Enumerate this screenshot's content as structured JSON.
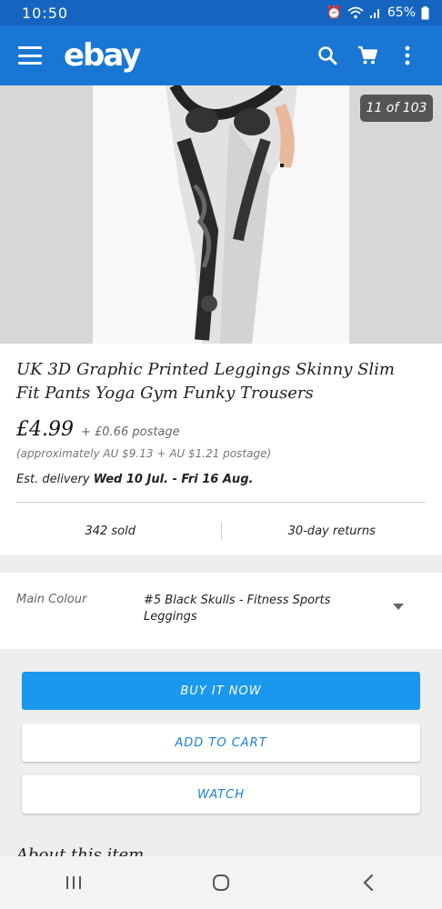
{
  "status_bar": {
    "time": "10:50",
    "battery": "65%"
  },
  "app_bar": {
    "logo": "ebay",
    "icons": [
      "menu-icon",
      "search-icon",
      "cart-icon",
      "more-vert-icon"
    ]
  },
  "gallery": {
    "counter": "11 of 103"
  },
  "item": {
    "title": "UK 3D Graphic Printed  Leggings Skinny Slim Fit Pants Yoga Gym Funky Trousers",
    "price": "£4.99",
    "postage": "+ £0.66 postage",
    "approx": "(approximately AU $9.13 + AU $1.21 postage)",
    "delivery_label": "Est. delivery",
    "delivery_dates": "Wed 10 Jul. - Fri 16 Aug.",
    "sold": "342 sold",
    "returns": "30-day returns"
  },
  "variation": {
    "label": "Main Colour",
    "value": "#5 Black Skulls - Fitness Sports Leggings"
  },
  "actions": {
    "buy_now": "BUY IT NOW",
    "add_to_cart": "ADD TO CART",
    "watch": "WATCH"
  },
  "about": {
    "heading": "About this item"
  },
  "colors": {
    "status_bar": "#1565c0",
    "app_bar": "#1976d2",
    "buy_button": "#1a98ee",
    "link_blue": "#1a7fd6"
  }
}
